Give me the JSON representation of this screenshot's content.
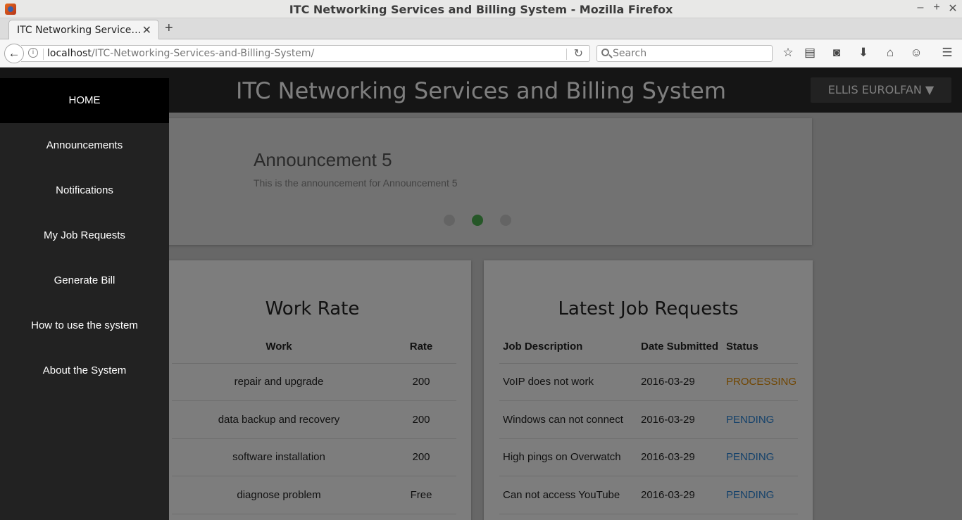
{
  "window": {
    "title": "ITC Networking Services and Billing System - Mozilla Firefox",
    "controls": {
      "minimize": "–",
      "maximize": "+",
      "close": "✕"
    }
  },
  "tab": {
    "title": "ITC Networking Service…",
    "close": "✕",
    "new_tab": "+"
  },
  "navbar": {
    "url_host": "localhost",
    "url_path": "/ITC-Networking-Services-and-Billing-System/",
    "search_placeholder": "Search",
    "icons": [
      "bookmark-star-icon",
      "reading-list-icon",
      "pocket-icon",
      "download-icon",
      "home-icon",
      "chat-icon",
      "menu-icon"
    ]
  },
  "app": {
    "title": "ITC Networking Services and Billing System",
    "user_label": "ELLIS EUROLFAN ▼"
  },
  "sidebar": {
    "items": [
      {
        "label": "HOME",
        "active": true
      },
      {
        "label": "Announcements"
      },
      {
        "label": "Notifications"
      },
      {
        "label": "My Job Requests"
      },
      {
        "label": "Generate Bill"
      },
      {
        "label": "How to use the system"
      },
      {
        "label": "About the System"
      }
    ]
  },
  "carousel": {
    "title": "Announcement 5",
    "body": "This is the announcement for Announcement 5",
    "dots": 3,
    "active_dot": 2
  },
  "work_rate": {
    "title": "Work Rate",
    "headers": [
      "Work",
      "Rate"
    ],
    "rows": [
      [
        "repair and upgrade",
        "200"
      ],
      [
        "data backup and recovery",
        "200"
      ],
      [
        "software installation",
        "200"
      ],
      [
        "diagnose problem",
        "Free"
      ]
    ]
  },
  "latest_jobs": {
    "title": "Latest Job Requests",
    "headers": [
      "Job Description",
      "Date Submitted",
      "Status"
    ],
    "rows": [
      [
        "VoIP does not work",
        "2016-03-29",
        "PROCESSING"
      ],
      [
        "Windows can not connect",
        "2016-03-29",
        "PENDING"
      ],
      [
        "High pings on Overwatch",
        "2016-03-29",
        "PENDING"
      ],
      [
        "Can not access YouTube",
        "2016-03-29",
        "PENDING"
      ]
    ],
    "status_colors": {
      "PROCESSING": "#e08b00",
      "PENDING": "#2b84d6"
    }
  }
}
